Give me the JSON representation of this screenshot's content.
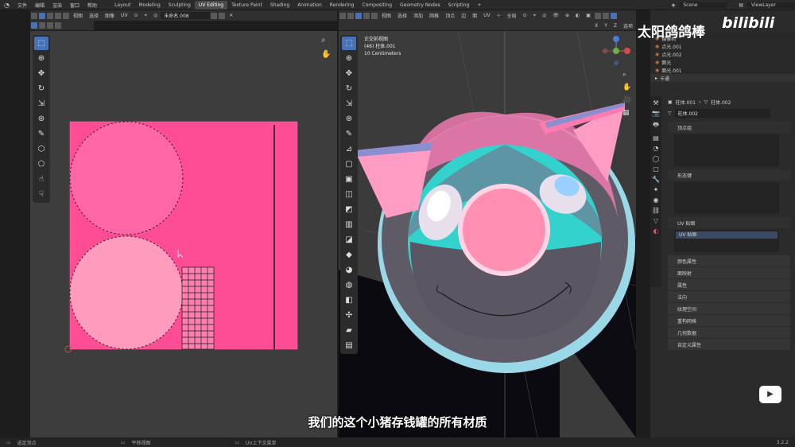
{
  "topbar": {
    "menus": [
      "文件",
      "编辑",
      "渲染",
      "窗口",
      "帮助"
    ],
    "workspaces": [
      "Layout",
      "Modeling",
      "Sculpting",
      "UV Editing",
      "Texture Paint",
      "Shading",
      "Animation",
      "Rendering",
      "Compositing",
      "Geometry Nodes",
      "Scripting"
    ],
    "active_workspace": "UV Editing",
    "scene": "Scene",
    "view_layer": "ViewLayer"
  },
  "uv_editor": {
    "header_menus": [
      "视图",
      "选择",
      "图像",
      "UV"
    ],
    "image_name": "未命名.008",
    "status_left": "选定顶点"
  },
  "viewport": {
    "header_menus": [
      "视图",
      "选择",
      "添加",
      "网格",
      "顶点",
      "边",
      "面",
      "UV"
    ],
    "orientation": "全局",
    "view_name": "正交前视图",
    "object_label": "(46) 柱体.001",
    "scale_label": "10 Centimeters",
    "axis_labels": [
      "X",
      "Y",
      "Z"
    ],
    "status_mid": "平移视图",
    "status_right": "UV上下文菜单",
    "options_label": "选项"
  },
  "subtitle": "我们的这个小猪存钱罐的所有材质",
  "watermark": {
    "author": "太阳鸽鸽棒",
    "logo": "bilibili"
  },
  "outliner": {
    "rows": [
      {
        "label": "摄像机"
      },
      {
        "label": "点光.001"
      },
      {
        "label": "点光.002"
      },
      {
        "label": "面光"
      },
      {
        "label": "面光.001"
      },
      {
        "label": "卡通"
      }
    ]
  },
  "properties": {
    "object_name": "柱体.001",
    "mesh_name": "柱体.002",
    "data_name": "柱体.002",
    "vertex_groups": "顶点组",
    "shape_keys": "形态键",
    "uv_maps": "UV 贴图",
    "uv_map_item": "UV 贴图",
    "sections": [
      "颜色属性",
      "面映射",
      "属性",
      "法向",
      "纹理空间",
      "重构网格",
      "几何数据",
      "自定义属性"
    ]
  },
  "version": "3.2.2",
  "colors": {
    "uv_bg": "#ff4d95",
    "uv_island": "#ff94b8",
    "accent": "#4772b3",
    "pig_teal": "#2fd6cf",
    "pig_pink": "#ff8fb3"
  }
}
